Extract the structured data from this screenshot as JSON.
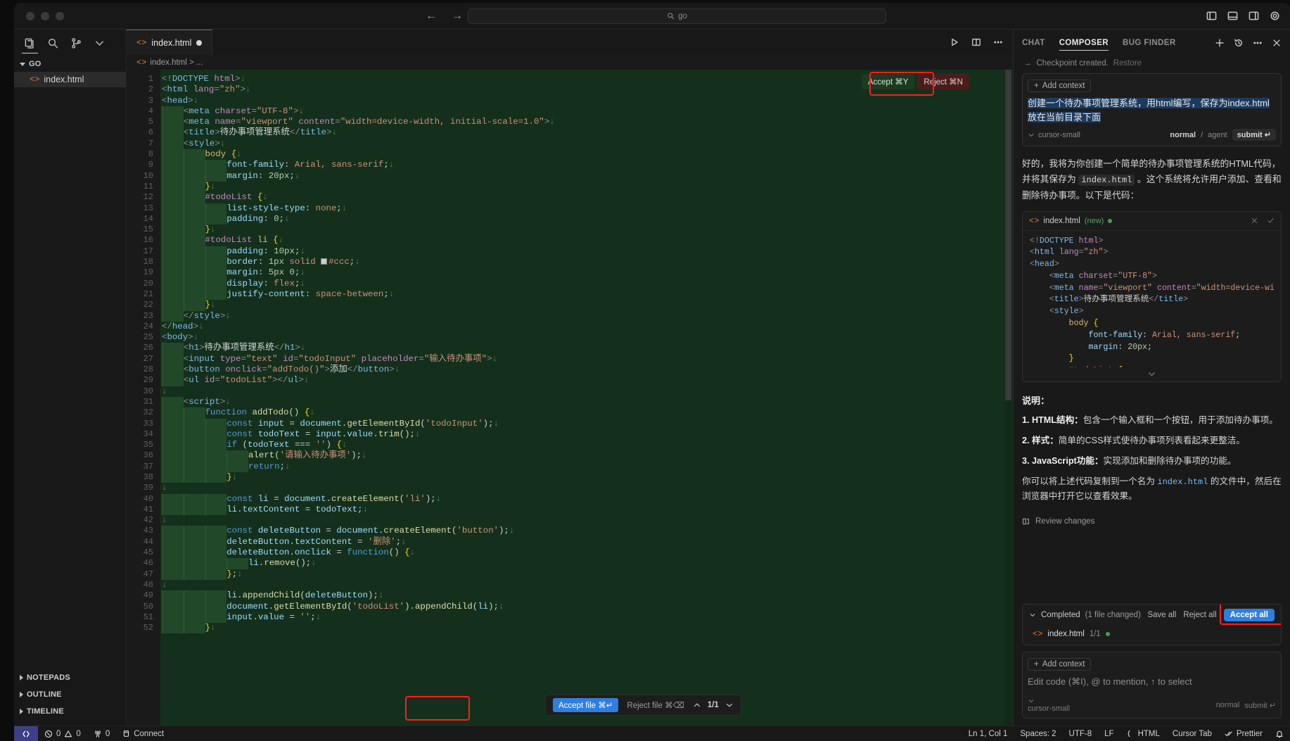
{
  "titlebar": {
    "go_placeholder": "go",
    "back_icon": "arrow-left-icon",
    "forward_icon": "arrow-right-icon"
  },
  "sidebar": {
    "activity": [
      "explorer-icon",
      "search-icon",
      "source-control-icon",
      "chevron-down-icon"
    ],
    "section_title": "GO",
    "file": "index.html",
    "bottom_sections": [
      "NOTEPADS",
      "OUTLINE",
      "TIMELINE"
    ]
  },
  "editor": {
    "tab_label": "index.html",
    "breadcrumb": "index.html  >  ...",
    "accept_label": "Accept ⌘Y",
    "reject_label": "Reject ⌘N",
    "accept_file_label": "Accept file ⌘↵",
    "reject_file_label": "Reject file ⌘⌫",
    "nav_count": "1/1"
  },
  "code_lines": [
    {
      "n": 1,
      "indent": 0,
      "html": "<span class='t-br'>&lt;!</span><span class='t-tag'>DOCTYPE</span> <span class='t-attr'>html</span><span class='t-br'>&gt;</span><span class='t-eol'>↓</span>"
    },
    {
      "n": 2,
      "indent": 0,
      "html": "<span class='t-br'>&lt;</span><span class='t-tag'>html</span> <span class='t-attr'>lang</span><span class='t-br'>=</span><span class='t-str'>\"zh\"</span><span class='t-br'>&gt;</span><span class='t-eol'>↓</span>"
    },
    {
      "n": 3,
      "indent": 0,
      "html": "<span class='t-br'>&lt;</span><span class='t-tag'>head</span><span class='t-br'>&gt;</span><span class='t-eol'>↓</span>"
    },
    {
      "n": 4,
      "indent": 1,
      "html": "<span class='t-br'>&lt;</span><span class='t-tag'>meta</span> <span class='t-attr'>charset</span><span class='t-br'>=</span><span class='t-str'>\"UTF-8\"</span><span class='t-br'>&gt;</span><span class='t-eol'>↓</span>"
    },
    {
      "n": 5,
      "indent": 1,
      "html": "<span class='t-br'>&lt;</span><span class='t-tag'>meta</span> <span class='t-attr'>name</span><span class='t-br'>=</span><span class='t-str'>\"viewport\"</span> <span class='t-attr'>content</span><span class='t-br'>=</span><span class='t-str'>\"width=device-width, initial-scale=1.0\"</span><span class='t-br'>&gt;</span><span class='t-eol'>↓</span>"
    },
    {
      "n": 6,
      "indent": 1,
      "html": "<span class='t-br'>&lt;</span><span class='t-tag'>title</span><span class='t-br'>&gt;</span><span class='t-txt'>待办事项管理系统</span><span class='t-br'>&lt;/</span><span class='t-tag'>title</span><span class='t-br'>&gt;</span><span class='t-eol'>↓</span>"
    },
    {
      "n": 7,
      "indent": 1,
      "html": "<span class='t-br'>&lt;</span><span class='t-tag'>style</span><span class='t-br'>&gt;</span><span class='t-eol'>↓</span>"
    },
    {
      "n": 8,
      "indent": 2,
      "html": "<span class='t-sel'>body</span> <span class='t-brace'>{</span><span class='t-eol'>↓</span>"
    },
    {
      "n": 9,
      "indent": 3,
      "html": "<span class='t-prop'>font-family</span><span class='t-punct'>:</span> <span class='t-val'>Arial, sans-serif</span><span class='t-punct'>;</span><span class='t-eol'>↓</span>"
    },
    {
      "n": 10,
      "indent": 3,
      "html": "<span class='t-prop'>margin</span><span class='t-punct'>:</span> <span class='t-num'>20px</span><span class='t-punct'>;</span><span class='t-eol'>↓</span>"
    },
    {
      "n": 11,
      "indent": 2,
      "html": "<span class='t-brace'>}</span><span class='t-eol'>↓</span>"
    },
    {
      "n": 12,
      "indent": 2,
      "html": "<span class='t-attr'>#todoList</span> <span class='t-brace'>{</span><span class='t-eol'>↓</span>"
    },
    {
      "n": 13,
      "indent": 3,
      "html": "<span class='t-prop'>list-style-type</span><span class='t-punct'>:</span> <span class='t-val'>none</span><span class='t-punct'>;</span><span class='t-eol'>↓</span>"
    },
    {
      "n": 14,
      "indent": 3,
      "html": "<span class='t-prop'>padding</span><span class='t-punct'>:</span> <span class='t-num'>0</span><span class='t-punct'>;</span><span class='t-eol'>↓</span>"
    },
    {
      "n": 15,
      "indent": 2,
      "html": "<span class='t-brace'>}</span><span class='t-eol'>↓</span>"
    },
    {
      "n": 16,
      "indent": 2,
      "html": "<span class='t-attr'>#todoList</span> <span class='t-sel'>li</span> <span class='t-brace'>{</span><span class='t-eol'>↓</span>"
    },
    {
      "n": 17,
      "indent": 3,
      "html": "<span class='t-prop'>padding</span><span class='t-punct'>:</span> <span class='t-num'>10px</span><span class='t-punct'>;</span><span class='t-eol'>↓</span>"
    },
    {
      "n": 18,
      "indent": 3,
      "html": "<span class='t-prop'>border</span><span class='t-punct'>:</span> <span class='t-num'>1px</span> <span class='t-val'>solid</span> <span class='swatch'></span><span class='t-val'>#ccc</span><span class='t-punct'>;</span><span class='t-eol'>↓</span>"
    },
    {
      "n": 19,
      "indent": 3,
      "html": "<span class='t-prop'>margin</span><span class='t-punct'>:</span> <span class='t-num'>5px 0</span><span class='t-punct'>;</span><span class='t-eol'>↓</span>"
    },
    {
      "n": 20,
      "indent": 3,
      "html": "<span class='t-prop'>display</span><span class='t-punct'>:</span> <span class='t-val'>flex</span><span class='t-punct'>;</span><span class='t-eol'>↓</span>"
    },
    {
      "n": 21,
      "indent": 3,
      "html": "<span class='t-prop'>justify-content</span><span class='t-punct'>:</span> <span class='t-val'>space-between</span><span class='t-punct'>;</span><span class='t-eol'>↓</span>"
    },
    {
      "n": 22,
      "indent": 2,
      "html": "<span class='t-brace'>}</span><span class='t-eol'>↓</span>"
    },
    {
      "n": 23,
      "indent": 1,
      "html": "<span class='t-br'>&lt;/</span><span class='t-tag'>style</span><span class='t-br'>&gt;</span><span class='t-eol'>↓</span>"
    },
    {
      "n": 24,
      "indent": 0,
      "html": "<span class='t-br'>&lt;/</span><span class='t-tag'>head</span><span class='t-br'>&gt;</span><span class='t-eol'>↓</span>"
    },
    {
      "n": 25,
      "indent": 0,
      "html": "<span class='t-br'>&lt;</span><span class='t-tag'>body</span><span class='t-br'>&gt;</span><span class='t-eol'>↓</span>"
    },
    {
      "n": 26,
      "indent": 1,
      "html": "<span class='t-br'>&lt;</span><span class='t-tag'>h1</span><span class='t-br'>&gt;</span><span class='t-txt'>待办事项管理系统</span><span class='t-br'>&lt;/</span><span class='t-tag'>h1</span><span class='t-br'>&gt;</span><span class='t-eol'>↓</span>"
    },
    {
      "n": 27,
      "indent": 1,
      "html": "<span class='t-br'>&lt;</span><span class='t-tag'>input</span> <span class='t-attr'>type</span><span class='t-br'>=</span><span class='t-str'>\"text\"</span> <span class='t-attr'>id</span><span class='t-br'>=</span><span class='t-str'>\"todoInput\"</span> <span class='t-attr'>placeholder</span><span class='t-br'>=</span><span class='t-str'>\"输入待办事项\"</span><span class='t-br'>&gt;</span><span class='t-eol'>↓</span>"
    },
    {
      "n": 28,
      "indent": 1,
      "html": "<span class='t-br'>&lt;</span><span class='t-tag'>button</span> <span class='t-attr'>onclick</span><span class='t-br'>=</span><span class='t-str'>\"addTodo()\"</span><span class='t-br'>&gt;</span><span class='t-txt'>添加</span><span class='t-br'>&lt;/</span><span class='t-tag'>button</span><span class='t-br'>&gt;</span><span class='t-eol'>↓</span>"
    },
    {
      "n": 29,
      "indent": 1,
      "html": "<span class='t-br'>&lt;</span><span class='t-tag'>ul</span> <span class='t-attr'>id</span><span class='t-br'>=</span><span class='t-str'>\"todoList\"</span><span class='t-br'>&gt;&lt;/</span><span class='t-tag'>ul</span><span class='t-br'>&gt;</span><span class='t-eol'>↓</span>"
    },
    {
      "n": 30,
      "indent": 0,
      "html": "<span class='t-eol'>↓</span>"
    },
    {
      "n": 31,
      "indent": 1,
      "html": "<span class='t-br'>&lt;</span><span class='t-tag'>script</span><span class='t-br'>&gt;</span><span class='t-eol'>↓</span>"
    },
    {
      "n": 32,
      "indent": 2,
      "html": "<span class='t-kw'>function</span> <span class='t-fn'>addTodo</span><span class='t-punct'>()</span> <span class='t-brace'>{</span><span class='t-eol'>↓</span>"
    },
    {
      "n": 33,
      "indent": 3,
      "html": "<span class='t-kw'>const</span> <span class='t-var'>input</span> <span class='t-punct'>=</span> <span class='t-var'>document</span><span class='t-punct'>.</span><span class='t-meth'>getElementById</span><span class='t-punct'>(</span><span class='t-str'>'todoInput'</span><span class='t-punct'>);</span><span class='t-eol'>↓</span>"
    },
    {
      "n": 34,
      "indent": 3,
      "html": "<span class='t-kw'>const</span> <span class='t-var'>todoText</span> <span class='t-punct'>=</span> <span class='t-var'>input</span><span class='t-punct'>.</span><span class='t-var'>value</span><span class='t-punct'>.</span><span class='t-meth'>trim</span><span class='t-punct'>();</span><span class='t-eol'>↓</span>"
    },
    {
      "n": 35,
      "indent": 3,
      "html": "<span class='t-kw'>if</span> <span class='t-punct'>(</span><span class='t-var'>todoText</span> <span class='t-punct'>===</span> <span class='t-str'>''</span><span class='t-punct'>)</span> <span class='t-brace'>{</span><span class='t-eol'>↓</span>"
    },
    {
      "n": 36,
      "indent": 4,
      "html": "<span class='t-fn'>alert</span><span class='t-punct'>(</span><span class='t-str'>'请输入待办事项'</span><span class='t-punct'>);</span><span class='t-eol'>↓</span>"
    },
    {
      "n": 37,
      "indent": 4,
      "html": "<span class='t-kw'>return</span><span class='t-punct'>;</span><span class='t-eol'>↓</span>"
    },
    {
      "n": 38,
      "indent": 3,
      "html": "<span class='t-brace'>}</span><span class='t-eol'>↓</span>"
    },
    {
      "n": 39,
      "indent": 0,
      "html": "<span class='t-eol'>↓</span>"
    },
    {
      "n": 40,
      "indent": 3,
      "html": "<span class='t-kw'>const</span> <span class='t-var'>li</span> <span class='t-punct'>=</span> <span class='t-var'>document</span><span class='t-punct'>.</span><span class='t-meth'>createElement</span><span class='t-punct'>(</span><span class='t-str'>'li'</span><span class='t-punct'>);</span><span class='t-eol'>↓</span>"
    },
    {
      "n": 41,
      "indent": 3,
      "html": "<span class='t-var'>li</span><span class='t-punct'>.</span><span class='t-var'>textContent</span> <span class='t-punct'>=</span> <span class='t-var'>todoText</span><span class='t-punct'>;</span><span class='t-eol'>↓</span>"
    },
    {
      "n": 42,
      "indent": 0,
      "html": "<span class='t-eol'>↓</span>"
    },
    {
      "n": 43,
      "indent": 3,
      "html": "<span class='t-kw'>const</span> <span class='t-var'>deleteButton</span> <span class='t-punct'>=</span> <span class='t-var'>document</span><span class='t-punct'>.</span><span class='t-meth'>createElement</span><span class='t-punct'>(</span><span class='t-str'>'button'</span><span class='t-punct'>);</span><span class='t-eol'>↓</span>"
    },
    {
      "n": 44,
      "indent": 3,
      "html": "<span class='t-var'>deleteButton</span><span class='t-punct'>.</span><span class='t-var'>textContent</span> <span class='t-punct'>=</span> <span class='t-str'>'删除'</span><span class='t-punct'>;</span><span class='t-eol'>↓</span>"
    },
    {
      "n": 45,
      "indent": 3,
      "html": "<span class='t-var'>deleteButton</span><span class='t-punct'>.</span><span class='t-var'>onclick</span> <span class='t-punct'>=</span> <span class='t-kw'>function</span><span class='t-punct'>()</span> <span class='t-brace'>{</span><span class='t-eol'>↓</span>"
    },
    {
      "n": 46,
      "indent": 4,
      "html": "<span class='t-var'>li</span><span class='t-punct'>.</span><span class='t-meth'>remove</span><span class='t-punct'>();</span><span class='t-eol'>↓</span>"
    },
    {
      "n": 47,
      "indent": 3,
      "html": "<span class='t-brace'>}</span><span class='t-punct'>;</span><span class='t-eol'>↓</span>"
    },
    {
      "n": 48,
      "indent": 0,
      "html": "<span class='t-eol'>↓</span>"
    },
    {
      "n": 49,
      "indent": 3,
      "html": "<span class='t-var'>li</span><span class='t-punct'>.</span><span class='t-meth'>appendChild</span><span class='t-punct'>(</span><span class='t-var'>deleteButton</span><span class='t-punct'>);</span><span class='t-eol'>↓</span>"
    },
    {
      "n": 50,
      "indent": 3,
      "html": "<span class='t-var'>document</span><span class='t-punct'>.</span><span class='t-meth'>getElementById</span><span class='t-punct'>(</span><span class='t-str'>'todoList'</span><span class='t-punct'>).</span><span class='t-meth'>appendChild</span><span class='t-punct'>(</span><span class='t-var'>li</span><span class='t-punct'>);</span><span class='t-eol'>↓</span>"
    },
    {
      "n": 51,
      "indent": 3,
      "html": "<span class='t-var'>input</span><span class='t-punct'>.</span><span class='t-var'>value</span> <span class='t-punct'>=</span> <span class='t-str'>''</span><span class='t-punct'>;</span><span class='t-eol'>↓</span>"
    },
    {
      "n": 52,
      "indent": 2,
      "html": "<span class='t-brace'>}</span><span class='t-eol'>↓</span>"
    }
  ],
  "chat": {
    "tabs": [
      "CHAT",
      "COMPOSER",
      "BUG FINDER"
    ],
    "active_tab": "COMPOSER",
    "checkpoint": "Checkpoint created.",
    "checkpoint_restore": "Restore",
    "add_context": "Add context",
    "prompt": "创建一个待办事项管理系统，用html编写，保存为index.html 放在当前目录下面",
    "model": "cursor-small",
    "mode": "normal",
    "mode_alt": "agent",
    "submit": "submit",
    "assistant_p1_a": "好的，我将为你创建一个简单的待办事项管理系统的HTML代码，并将其保存为 ",
    "assistant_p1_code": "index.html",
    "assistant_p1_b": " 。这个系统将允许用户添加、查看和删除待办事项。以下是代码：",
    "code_card_file": "index.html",
    "code_card_tag": "(new)",
    "code_card_lines": [
      {
        "html": "<span class='t-br'>&lt;!</span><span class='t-tag'>DOCTYPE</span> <span class='t-attr'>html</span><span class='t-br'>&gt;</span>"
      },
      {
        "html": "<span class='t-br'>&lt;</span><span class='t-tag'>html</span> <span class='t-attr'>lang</span><span class='t-br'>=</span><span class='t-str'>\"zh\"</span><span class='t-br'>&gt;</span>"
      },
      {
        "html": "<span class='t-br'>&lt;</span><span class='t-tag'>head</span><span class='t-br'>&gt;</span>"
      },
      {
        "html": "    <span class='t-br'>&lt;</span><span class='t-tag'>meta</span> <span class='t-attr'>charset</span><span class='t-br'>=</span><span class='t-str'>\"UTF-8\"</span><span class='t-br'>&gt;</span>"
      },
      {
        "html": "    <span class='t-br'>&lt;</span><span class='t-tag'>meta</span> <span class='t-attr'>name</span><span class='t-br'>=</span><span class='t-str'>\"viewport\"</span> <span class='t-attr'>content</span><span class='t-br'>=</span><span class='t-str'>\"width=device-wi</span>"
      },
      {
        "html": "    <span class='t-br'>&lt;</span><span class='t-tag'>title</span><span class='t-br'>&gt;</span><span class='t-txt'>待办事项管理系统</span><span class='t-br'>&lt;/</span><span class='t-tag'>title</span><span class='t-br'>&gt;</span>"
      },
      {
        "html": "    <span class='t-br'>&lt;</span><span class='t-tag'>style</span><span class='t-br'>&gt;</span>"
      },
      {
        "html": "        <span class='t-sel'>body</span> <span class='t-brace'>{</span>"
      },
      {
        "html": "            <span class='t-prop'>font-family</span><span class='t-punct'>:</span> <span class='t-val'>Arial, sans-serif</span><span class='t-punct'>;</span>"
      },
      {
        "html": "            <span class='t-prop'>margin</span><span class='t-punct'>:</span> <span class='t-num'>20px</span><span class='t-punct'>;</span>"
      },
      {
        "html": "        <span class='t-brace'>}</span>"
      },
      {
        "html": "        <span class='t-attr'>#todoList</span> <span class='t-brace'>{</span>"
      }
    ],
    "expl_title": "说明：",
    "expl_items": [
      {
        "num": "1. ",
        "bold": "HTML结构：",
        "text": "包含一个输入框和一个按钮，用于添加待办事项。"
      },
      {
        "num": "2. ",
        "bold": "样式：",
        "text": "简单的CSS样式使待办事项列表看起来更整洁。"
      },
      {
        "num": "3. ",
        "bold": "JavaScript功能：",
        "text": "实现添加和删除待办事项的功能。"
      }
    ],
    "closing_a": "你可以将上述代码复制到一个名为 ",
    "closing_code": "index.html",
    "closing_b": " 的文件中，然后在浏览器中打开它以查看效果。",
    "review_changes": "Review changes",
    "completed_label": "Completed",
    "completed_count": "(1 file changed)",
    "save_all": "Save all",
    "reject_all": "Reject all",
    "accept_all": "Accept all",
    "completed_file": "index.html",
    "completed_frac": "1/1",
    "input_hint": "Edit code (⌘I), @ to mention, ↑ to select"
  },
  "status": {
    "remote_icon": "remote-icon",
    "errors": "0",
    "warnings": "0",
    "radio": "0",
    "connect": "Connect",
    "position": "Ln 1, Col 1",
    "spaces": "Spaces: 2",
    "encoding": "UTF-8",
    "eol": "LF",
    "language": "HTML",
    "cursor_tab": "Cursor Tab",
    "prettier": "Prettier",
    "bell_icon": "bell-icon"
  },
  "colors": {
    "accent_blue": "#2f7fe0",
    "diff_green": "#14301c",
    "highlight_red": "#ff1d1d"
  }
}
